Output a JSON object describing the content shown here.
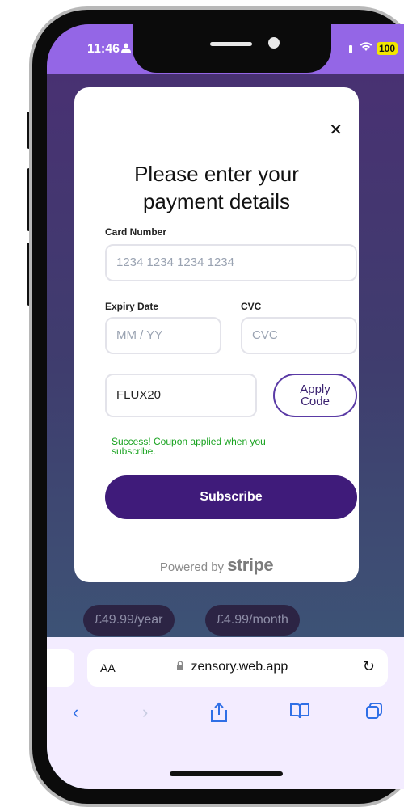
{
  "status_bar": {
    "time": "11:46",
    "battery": "100"
  },
  "modal": {
    "title_line1": "Please enter your",
    "title_line2": "payment details",
    "card_number_label": "Card Number",
    "card_number_placeholder": "1234 1234 1234 1234",
    "expiry_label": "Expiry Date",
    "expiry_placeholder": "MM / YY",
    "cvc_label": "CVC",
    "cvc_placeholder": "CVC",
    "coupon_value": "FLUX20",
    "apply_line1": "Apply",
    "apply_line2": "Code",
    "success_line1": "Success! Coupon applied when you",
    "success_line2": "subscribe.",
    "subscribe_label": "Subscribe",
    "powered_text": "Powered by",
    "powered_brand": "stripe"
  },
  "pricing": {
    "year": "£49.99/year",
    "month": "£4.99/month"
  },
  "browser": {
    "aa_label": "AA",
    "url": "zensory.web.app"
  },
  "colors": {
    "status_bar": "#9466e6",
    "subscribe_button": "#3f1b7a",
    "success_text": "#1aa321",
    "nav_icon": "#2f6fe6"
  }
}
